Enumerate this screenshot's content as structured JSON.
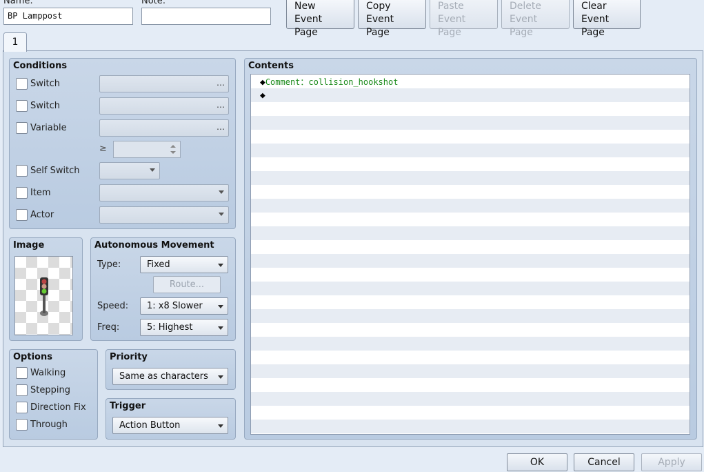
{
  "header": {
    "name_label": "Name:",
    "name_value": "BP Lamppost",
    "note_label": "Note:",
    "note_value": ""
  },
  "toolbar": {
    "new_page": "New\nEvent Page",
    "copy_page": "Copy\nEvent Page",
    "paste_page": "Paste\nEvent Page",
    "delete_page": "Delete\nEvent Page",
    "clear_page": "Clear\nEvent Page"
  },
  "tabs": [
    "1"
  ],
  "conditions": {
    "title": "Conditions",
    "switch1": "Switch",
    "switch2": "Switch",
    "variable": "Variable",
    "ge": "≥",
    "self_switch": "Self Switch",
    "item": "Item",
    "actor": "Actor",
    "dots": "…"
  },
  "image": {
    "title": "Image",
    "sprite_icon": "traffic-light-icon"
  },
  "movement": {
    "title": "Autonomous Movement",
    "type_label": "Type:",
    "type_value": "Fixed",
    "route_label": "Route...",
    "speed_label": "Speed:",
    "speed_value": "1: x8 Slower",
    "freq_label": "Freq:",
    "freq_value": "5: Highest"
  },
  "options": {
    "title": "Options",
    "walking": "Walking",
    "stepping": "Stepping",
    "direction_fix": "Direction Fix",
    "through": "Through"
  },
  "priority": {
    "title": "Priority",
    "value": "Same as characters"
  },
  "trigger": {
    "title": "Trigger",
    "value": "Action Button"
  },
  "contents": {
    "title": "Contents",
    "diamond": "◆",
    "commands": [
      {
        "prefix": "Comment：",
        "text": "collision_hookshot"
      }
    ]
  },
  "footer": {
    "ok": "OK",
    "cancel": "Cancel",
    "apply": "Apply"
  },
  "colors": {
    "comment_green": "#1a8a1a",
    "panel_blue": "#c4d4e7",
    "background": "#e4ecf6"
  }
}
